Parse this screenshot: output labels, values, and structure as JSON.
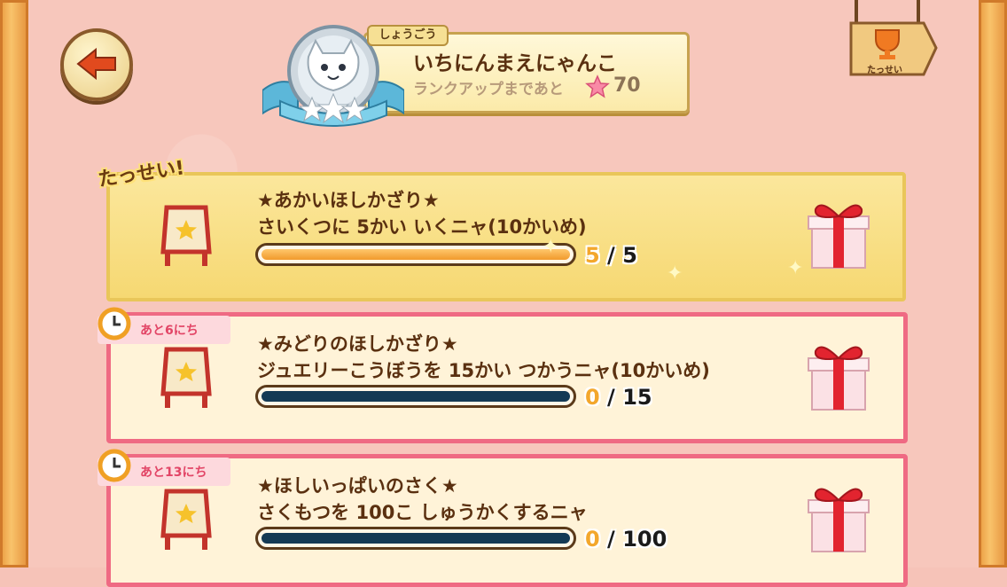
{
  "header": {
    "title_tag": "しょうごう",
    "title_name": "いちにんまえにゃんこ",
    "rankup_label": "ランクアップまであと",
    "rankup_value": "70",
    "achievement_button_label": "たっせい"
  },
  "tasks": [
    {
      "title": "★あかいほしかざり★",
      "description": "さいくつに 5かい いくニャ(10かいめ)",
      "current": "5",
      "total": "5",
      "progress": 1.0,
      "status_badge": "たっせい!",
      "days_left": ""
    },
    {
      "title": "★みどりのほしかざり★",
      "description": "ジュエリーこうぼうを 15かい つかうニャ(10かいめ)",
      "current": "0",
      "total": "15",
      "progress": 0.0,
      "status_badge": "",
      "days_left": "あと6にち"
    },
    {
      "title": "★ほしいっぱいのさく★",
      "description": "さくもつを 100こ しゅうかくするニャ",
      "current": "0",
      "total": "100",
      "progress": 0.0,
      "status_badge": "",
      "days_left": "あと13にち"
    }
  ],
  "icons": {
    "back": "back-arrow-icon",
    "medal": "cat-medal-icon",
    "trophy": "trophy-icon",
    "gift": "gift-box-icon",
    "clock": "clock-icon",
    "easel": "star-easel-icon",
    "star": "pink-star-icon"
  },
  "colors": {
    "completed_card": "#f6d872",
    "active_card_border": "#ef6a83",
    "progress_fill": "#f19a2c",
    "empty_bar": "#143a55",
    "text": "#5a3010"
  }
}
